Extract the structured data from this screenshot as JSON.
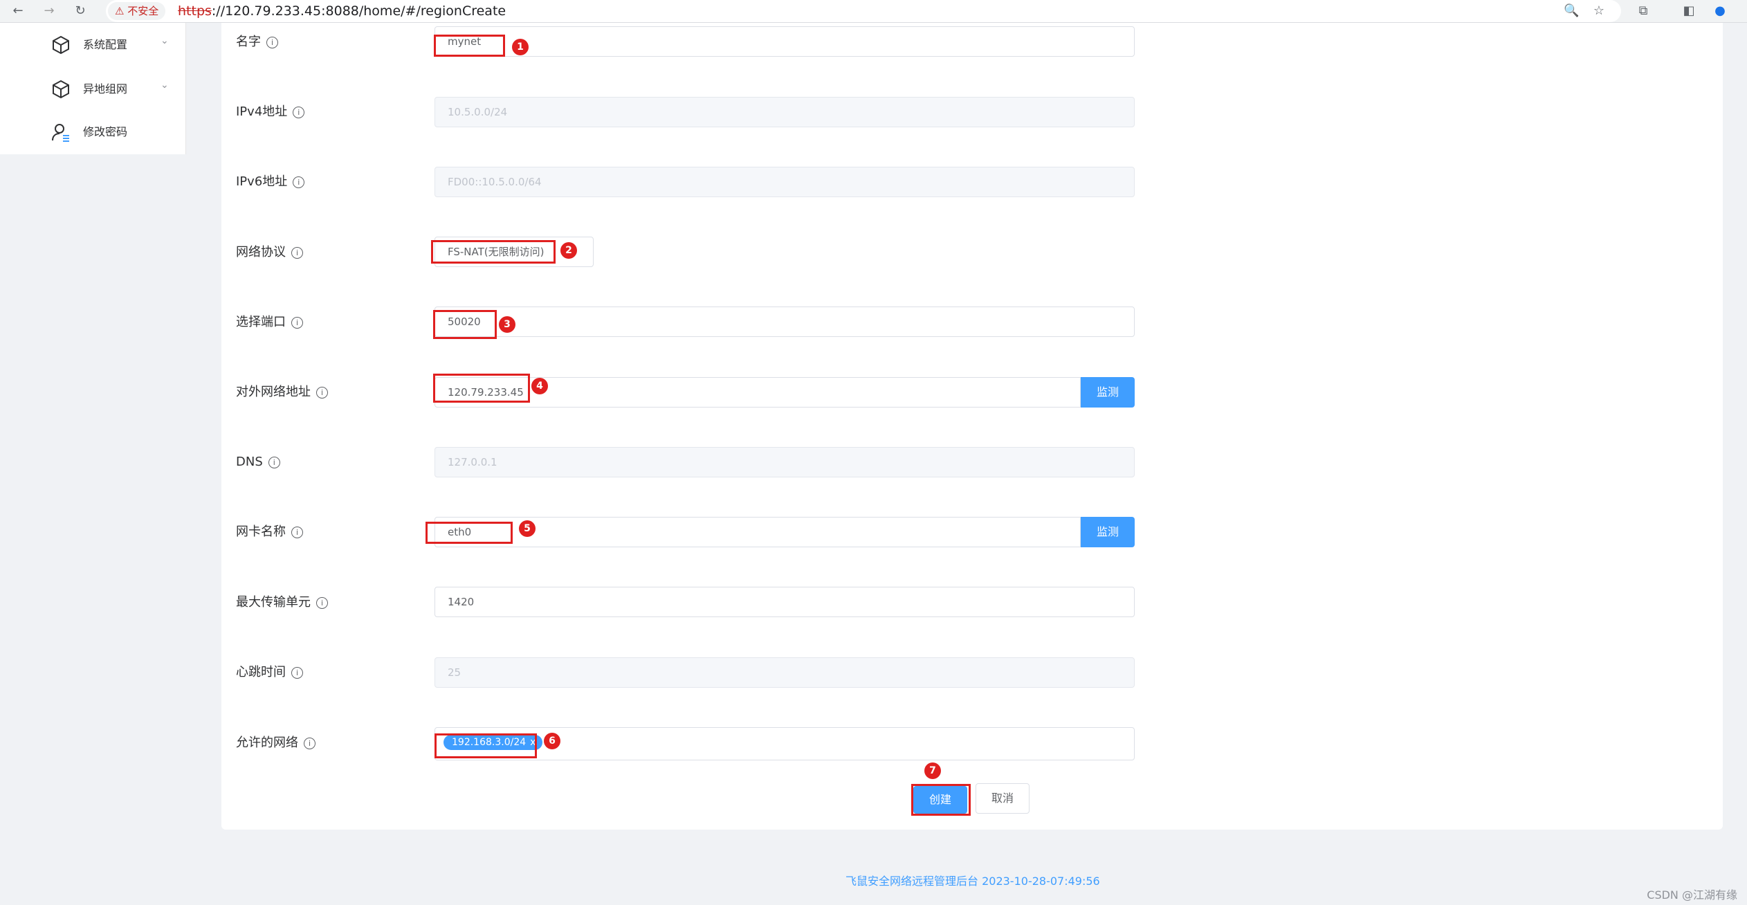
{
  "browser": {
    "insecure_label": "不安全",
    "url_protocol": "https",
    "url_rest": "://120.79.233.45:8088/home/#/regionCreate"
  },
  "sidebar": {
    "items": [
      {
        "label": "系统配置",
        "icon": "cube-icon",
        "has_arrow": true
      },
      {
        "label": "异地组网",
        "icon": "cube-icon",
        "has_arrow": true
      },
      {
        "label": "修改密码",
        "icon": "user-key-icon",
        "has_arrow": false
      }
    ]
  },
  "form": {
    "name": {
      "label": "名字",
      "value": "mynet",
      "badge": "1"
    },
    "ipv4": {
      "label": "IPv4地址",
      "value": "10.5.0.0/24"
    },
    "ipv6": {
      "label": "IPv6地址",
      "value": "FD00::10.5.0.0/64"
    },
    "protocol": {
      "label": "网络协议",
      "value": "FS-NAT(无限制访问)",
      "badge": "2"
    },
    "port": {
      "label": "选择端口",
      "value": "50020",
      "badge": "3"
    },
    "external": {
      "label": "对外网络地址",
      "value": "120.79.233.45",
      "badge": "4",
      "button": "监测"
    },
    "dns": {
      "label": "DNS",
      "value": "127.0.0.1"
    },
    "nic": {
      "label": "网卡名称",
      "value": "eth0",
      "badge": "5",
      "button": "监测"
    },
    "mtu": {
      "label": "最大传输单元",
      "value": "1420"
    },
    "heartbeat": {
      "label": "心跳时间",
      "value": "25"
    },
    "allowed": {
      "label": "允许的网络",
      "tag": "192.168.3.0/24",
      "tag_close": "x",
      "badge": "6"
    }
  },
  "actions": {
    "create_label": "创建",
    "cancel_label": "取消",
    "badge": "7"
  },
  "footer": {
    "text": "飞鼠安全网络远程管理后台 2023-10-28-07:49:56"
  },
  "watermark": "CSDN @江湖有缘",
  "colors": {
    "primary": "#409eff",
    "annotation_red": "#e02020"
  }
}
